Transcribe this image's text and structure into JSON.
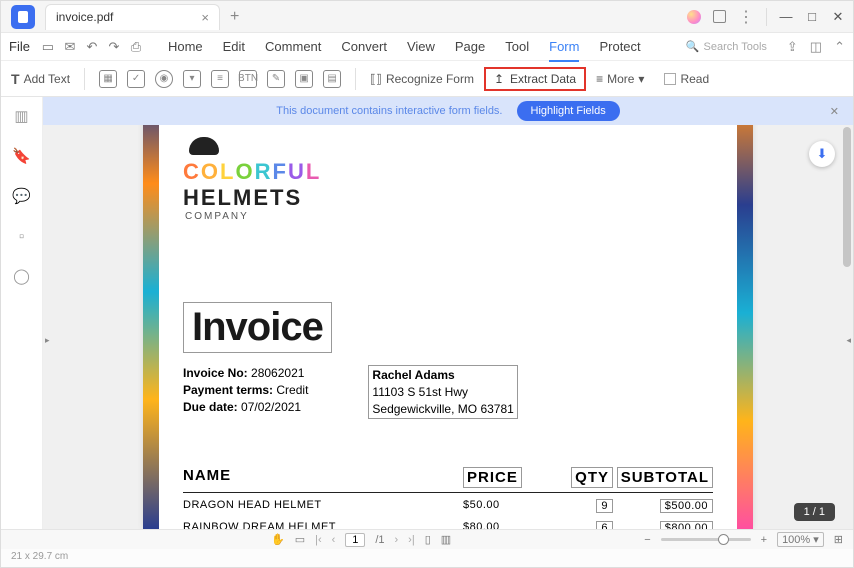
{
  "titlebar": {
    "tab": "invoice.pdf"
  },
  "toolbar1": {
    "file": "File",
    "menus": [
      "Home",
      "Edit",
      "Comment",
      "Convert",
      "View",
      "Page",
      "Tool",
      "Form",
      "Protect"
    ],
    "active": "Form",
    "search": "Search Tools"
  },
  "toolbar2": {
    "addText": "Add Text",
    "recognize": "Recognize Form",
    "extract": "Extract Data",
    "more": "More",
    "read": "Read"
  },
  "banner": {
    "text": "This document contains interactive form fields.",
    "button": "Highlight Fields"
  },
  "logo": {
    "line1_letters": [
      "C",
      "O",
      "L",
      "O",
      "R",
      "F",
      "U",
      "L"
    ],
    "line2": "HELMETS",
    "line3": "COMPANY"
  },
  "invoice": {
    "title": "Invoice",
    "no_label": "Invoice No:",
    "no": "28062021",
    "terms_label": "Payment terms:",
    "terms": "Credit",
    "due_label": "Due date:",
    "due": "07/02/2021",
    "customer_name": "Rachel Adams",
    "customer_addr1": "11103 S 51st Hwy",
    "customer_addr2": "Sedgewickville, MO 63781",
    "headers": {
      "name": "NAME",
      "price": "PRICE",
      "qty": "QTY",
      "subtotal": "SUBTOTAL"
    },
    "rows": [
      {
        "name": "DRAGON HEAD HELMET",
        "price": "$50.00",
        "qty": "9",
        "subtotal": "$500.00"
      },
      {
        "name": "RAINBOW DREAM HELMET",
        "price": "$80.00",
        "qty": "6",
        "subtotal": "$800.00"
      }
    ]
  },
  "pager": {
    "badge": "1 / 1",
    "current": "1",
    "total": "/1"
  },
  "status": {
    "dim": "21 x 29.7 cm",
    "zoom": "100%"
  }
}
